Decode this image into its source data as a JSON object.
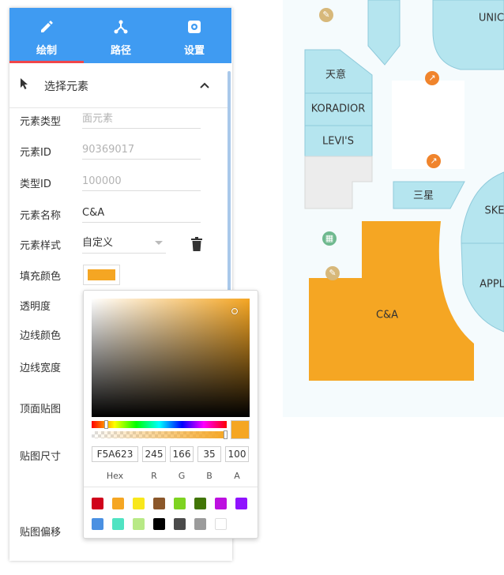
{
  "tabs": [
    {
      "label": "绘制",
      "icon": "pencil-icon",
      "active": true
    },
    {
      "label": "路径",
      "icon": "route-icon",
      "active": false
    },
    {
      "label": "设置",
      "icon": "gear-icon",
      "active": false
    }
  ],
  "select_section": {
    "title": "选择元素",
    "icon": "cursor-icon",
    "toggle_icon": "chevron-up-icon"
  },
  "fields": {
    "element_type": {
      "label": "元素类型",
      "value": "面元素"
    },
    "element_id": {
      "label": "元素ID",
      "value": "90369017"
    },
    "type_id": {
      "label": "类型ID",
      "value": "100000"
    },
    "element_name": {
      "label": "元素名称",
      "value": "C&A"
    },
    "element_style": {
      "label": "元素样式",
      "value": "自定义"
    },
    "fill_color": {
      "label": "填充颜色",
      "value": "#f5a623"
    },
    "opacity": {
      "label": "透明度"
    },
    "border_color": {
      "label": "边线颜色"
    },
    "border_width": {
      "label": "边线宽度"
    },
    "top_texture": {
      "label": "顶面贴图"
    },
    "texture_size": {
      "label": "贴图尺寸"
    },
    "texture_offset": {
      "label": "贴图偏移"
    }
  },
  "color_picker": {
    "hex": "F5A623",
    "r": "245",
    "g": "166",
    "b": "35",
    "a": "100",
    "labels": {
      "hex": "Hex",
      "r": "R",
      "g": "G",
      "b": "B",
      "a": "A"
    },
    "presets": [
      "#d0021b",
      "#f5a623",
      "#f8e71c",
      "#8b572a",
      "#7ed321",
      "#417505",
      "#bd10e0",
      "#9013fe",
      "#4a90e2",
      "#50e3c2",
      "#b8e986",
      "#000000",
      "#4a4a4a",
      "#9b9b9b",
      "#ffffff"
    ]
  },
  "map": {
    "shops": [
      "UNIC",
      "天意",
      "KORADIOR",
      "LEVI'S",
      "三星",
      "SKE",
      "APPL",
      "C&A"
    ],
    "colors": {
      "shop": "#b5e5ef",
      "selected": "#f5a623",
      "background": "#f5fbfd",
      "void": "#ececec",
      "atrium": "#ffffff"
    },
    "icons": [
      "wrench-icon",
      "escalator-icon",
      "escalator-icon",
      "atm-icon",
      "wrench-icon"
    ]
  },
  "colors": {
    "accent": "#3f9bf2",
    "active_tab_indicator": "#f0464a"
  }
}
